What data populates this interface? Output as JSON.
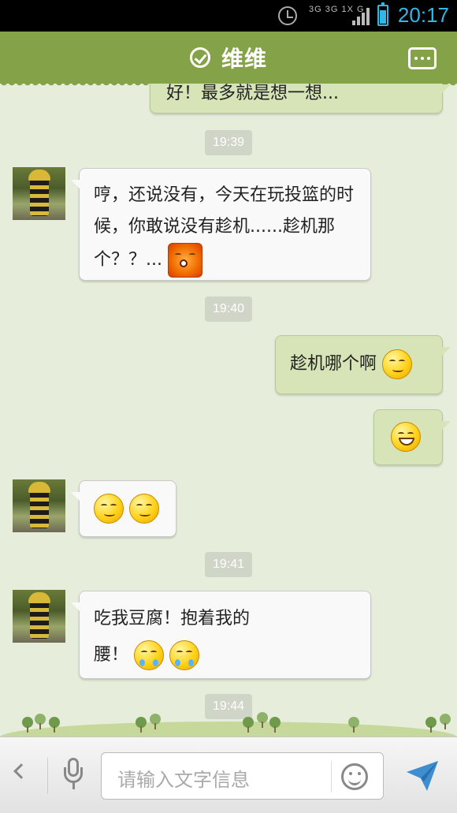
{
  "status_bar": {
    "network_top": "3G 3G 1X G",
    "clock": "20:17",
    "battery_level": 0.75,
    "accent_color": "#33b5e5"
  },
  "header": {
    "title": "维维",
    "verified_icon": "check-circle-icon",
    "menu_icon": "more-dots-icon",
    "bar_color": "#84a248"
  },
  "messages": {
    "partial_top": "好！最多就是想一想...",
    "time1": "19:39",
    "msg1_text": "哼，还说没有，今天在玩投篮的时候，你敢说没有趁机......趁机那个？？...",
    "time2": "19:40",
    "msg2_text": "趁机哪个啊",
    "time3": "19:41",
    "msg5_text": "吃我豆腐！抱着我的腰！",
    "time4": "19:44"
  },
  "input_bar": {
    "placeholder": "请输入文字信息",
    "left_icon": "back-arrow-icon",
    "voice_icon": "microphone-icon",
    "emoji_icon": "smiley-icon",
    "send_icon": "send-icon"
  }
}
